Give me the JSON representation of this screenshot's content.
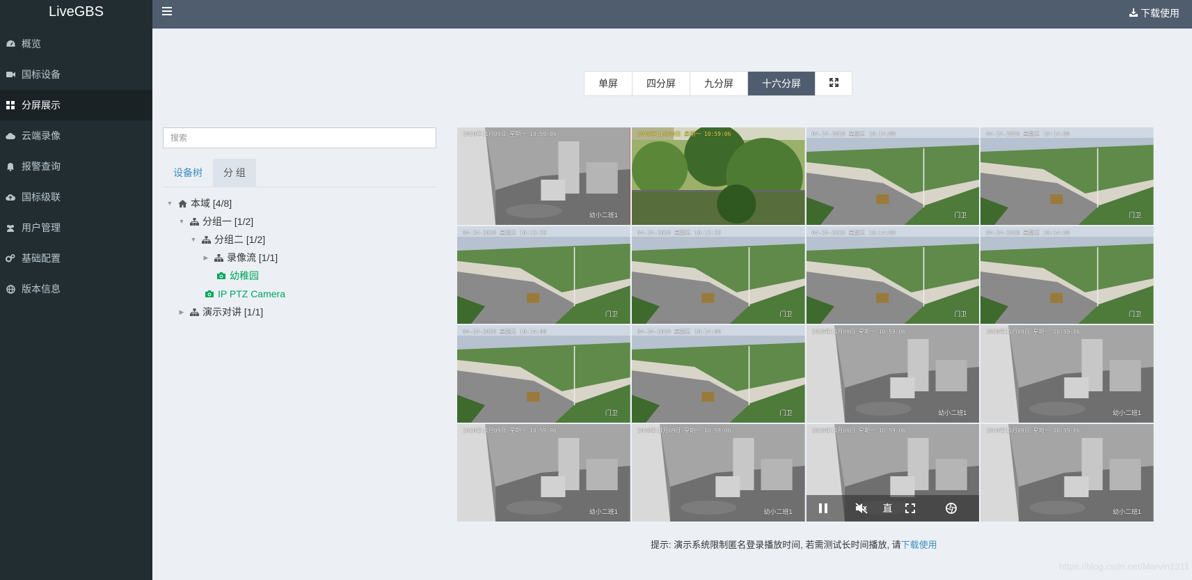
{
  "app": {
    "title": "LiveGBS"
  },
  "sidebar": {
    "items": [
      {
        "label": "概览",
        "icon": "dashboard-icon"
      },
      {
        "label": "国标设备",
        "icon": "video-camera-icon"
      },
      {
        "label": "分屏展示",
        "icon": "grid-icon",
        "active": true
      },
      {
        "label": "云端录像",
        "icon": "cloud-icon"
      },
      {
        "label": "报警查询",
        "icon": "bell-icon"
      },
      {
        "label": "国标级联",
        "icon": "cloud-upload-icon"
      },
      {
        "label": "用户管理",
        "icon": "users-icon"
      },
      {
        "label": "基础配置",
        "icon": "gears-icon"
      },
      {
        "label": "版本信息",
        "icon": "globe-icon"
      }
    ]
  },
  "header": {
    "download_label": "下载使用"
  },
  "screen_modes": {
    "single": "单屏",
    "quad": "四分屏",
    "nine": "九分屏",
    "sixteen": "十六分屏",
    "active": "十六分屏"
  },
  "search": {
    "placeholder": "搜索"
  },
  "tabs": {
    "device_tree": "设备树",
    "group": "分 组",
    "active": "分 组"
  },
  "tree": {
    "root": "本域 [4/8]",
    "group1": "分组一 [1/2]",
    "group2": "分组二 [1/2]",
    "recording": "录像流 [1/1]",
    "kindergarten": "幼稚园",
    "ipcam": "IP PTZ Camera",
    "demo": "演示对讲 [1/1]"
  },
  "video": {
    "osd_indoor": "2020年11月09日 星期一 10:59:06",
    "osd_outdoor": "04-24-2020 星期五 10:14:00",
    "osd_outdoor_b": "04-24-2020 星期五 10:13:59",
    "osd_tree": "2020年11月09日 星期一 10:59:06",
    "label_indoor": "幼小二班1",
    "label_outdoor": "门卫",
    "controls_live_label": "直"
  },
  "tip": {
    "text": "提示: 演示系统限制匿名登录播放时间, 若需测试长时间播放, 请",
    "link": "下载使用"
  },
  "watermark": "https://blog.csdn.net/Marvin1311",
  "colors": {
    "sidebar": "#222d32",
    "header": "#4f5d6e",
    "accent": "#3c8dbc",
    "camera_green": "#00a65a",
    "selected_border": "#ff0000"
  }
}
